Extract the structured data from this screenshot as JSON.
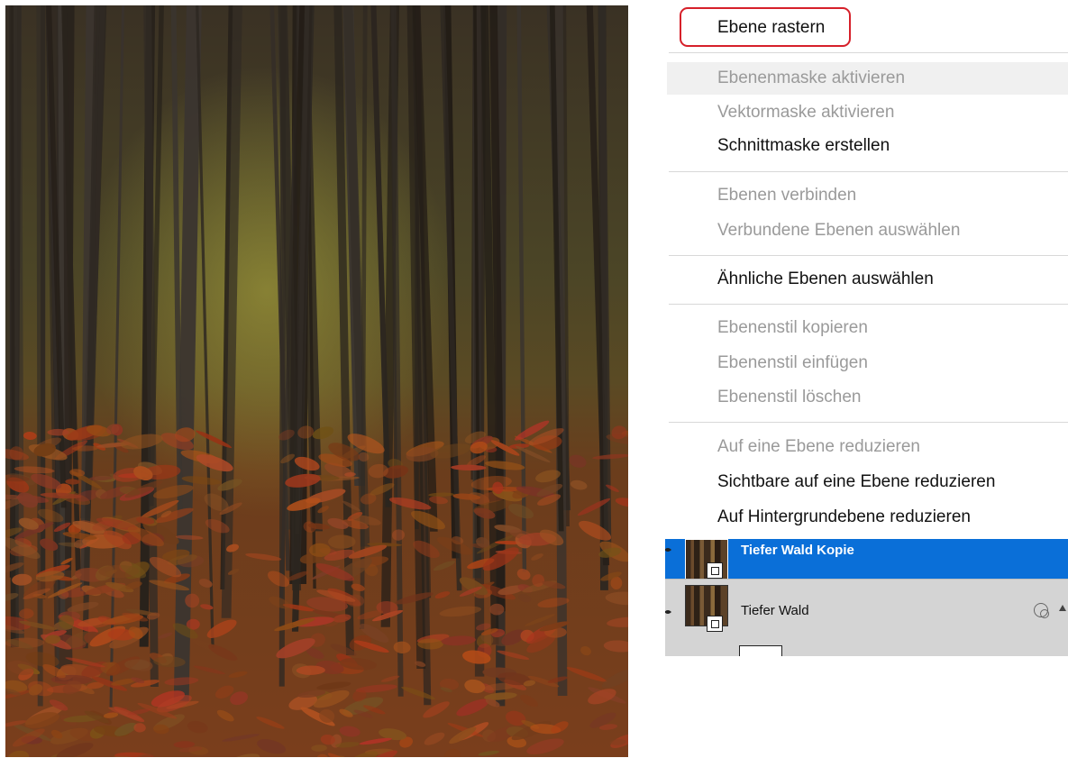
{
  "photo": {
    "subject": "forest-photo"
  },
  "menu": {
    "items": [
      {
        "label": "Ebene rastern",
        "enabled": true,
        "focused": true
      },
      {
        "label": "Ebenenmaske aktivieren",
        "enabled": false,
        "hover": true
      },
      {
        "label": "Vektormaske aktivieren",
        "enabled": false
      },
      {
        "label": "Schnittmaske erstellen",
        "enabled": true
      },
      {
        "label": "Ebenen verbinden",
        "enabled": false
      },
      {
        "label": "Verbundene Ebenen auswählen",
        "enabled": false
      },
      {
        "label": "Ähnliche Ebenen auswählen",
        "enabled": true
      },
      {
        "label": "Ebenenstil kopieren",
        "enabled": false
      },
      {
        "label": "Ebenenstil einfügen",
        "enabled": false
      },
      {
        "label": "Ebenenstil löschen",
        "enabled": false
      },
      {
        "label": "Auf eine Ebene reduzieren",
        "enabled": false
      },
      {
        "label": "Sichtbare auf eine Ebene reduzieren",
        "enabled": true
      },
      {
        "label": "Auf Hintergrundebene reduzieren",
        "enabled": true
      }
    ]
  },
  "layers": {
    "selected": {
      "name": "Tiefer Wald Kopie"
    },
    "other": {
      "name": "Tiefer Wald"
    }
  },
  "colors": {
    "focus_ring": "#d6202a",
    "selection": "#0a6fd8",
    "disabled_text": "#9a9a9a"
  }
}
